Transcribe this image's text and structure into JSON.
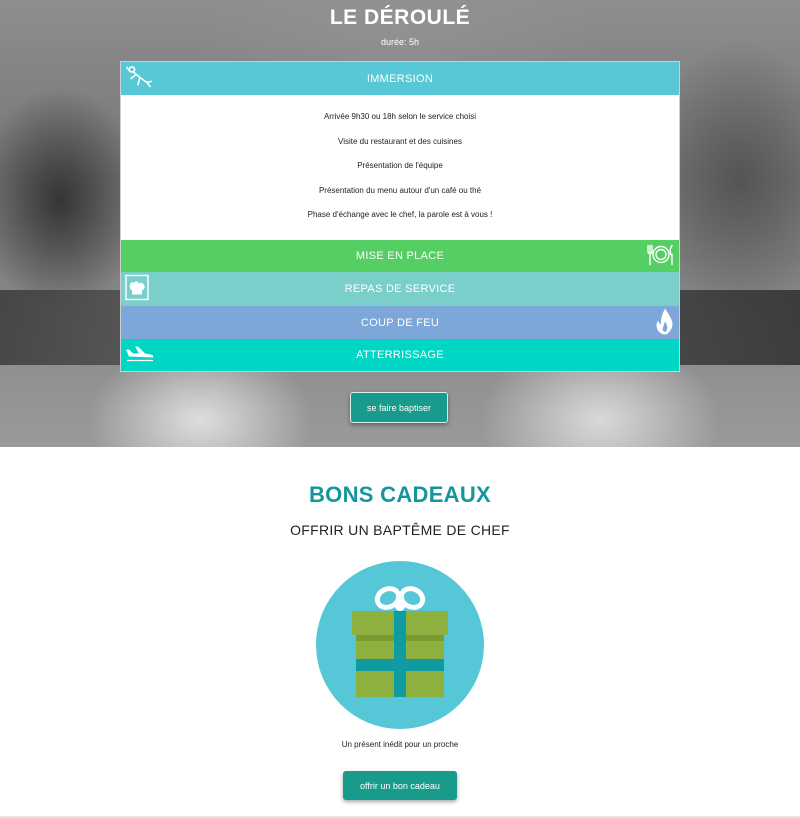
{
  "hero": {
    "title": "LE DÉROULÉ",
    "subtitle": "durée: 5h",
    "accent_color": "#58c8d6"
  },
  "accordion": {
    "items": [
      {
        "label": "IMMERSION",
        "color": "#58c8d6",
        "icon": "diver-icon",
        "expanded": true,
        "details": [
          "Arrivée 9h30 ou 18h selon le service choisi",
          "Visite du restaurant et des cuisines",
          "Présentation de l'équipe",
          "Présentation du menu autour d'un café ou thé",
          "Phase d'échange avec le chef, la parole est à vous !"
        ]
      },
      {
        "label": "MISE EN PLACE",
        "color": "#55ce63",
        "icon": "plate-cutlery-icon",
        "expanded": false
      },
      {
        "label": "REPAS DE SERVICE",
        "color": "#7acfcb",
        "icon": "chef-hat-icon",
        "expanded": false
      },
      {
        "label": "COUP DE FEU",
        "color": "#7da7d9",
        "icon": "flame-icon",
        "expanded": false
      },
      {
        "label": "ATTERRISSAGE",
        "color": "#00d6c4",
        "icon": "airplane-landing-icon",
        "expanded": false
      }
    ]
  },
  "cta": {
    "baptiser_label": "se faire baptiser",
    "button_color": "#199b8c"
  },
  "gift": {
    "title": "BONS CADEAUX",
    "subtitle": "OFFRIR UN BAPTÊME DE CHEF",
    "caption": "Un présent inédit pour un proche",
    "button_label": "offrir un bon cadeau",
    "icon": "gift-box-icon",
    "circle_color": "#56c7d6",
    "box_color": "#8eb03e",
    "ribbon_color": "#0f9ba0",
    "title_color": "#15959d"
  }
}
